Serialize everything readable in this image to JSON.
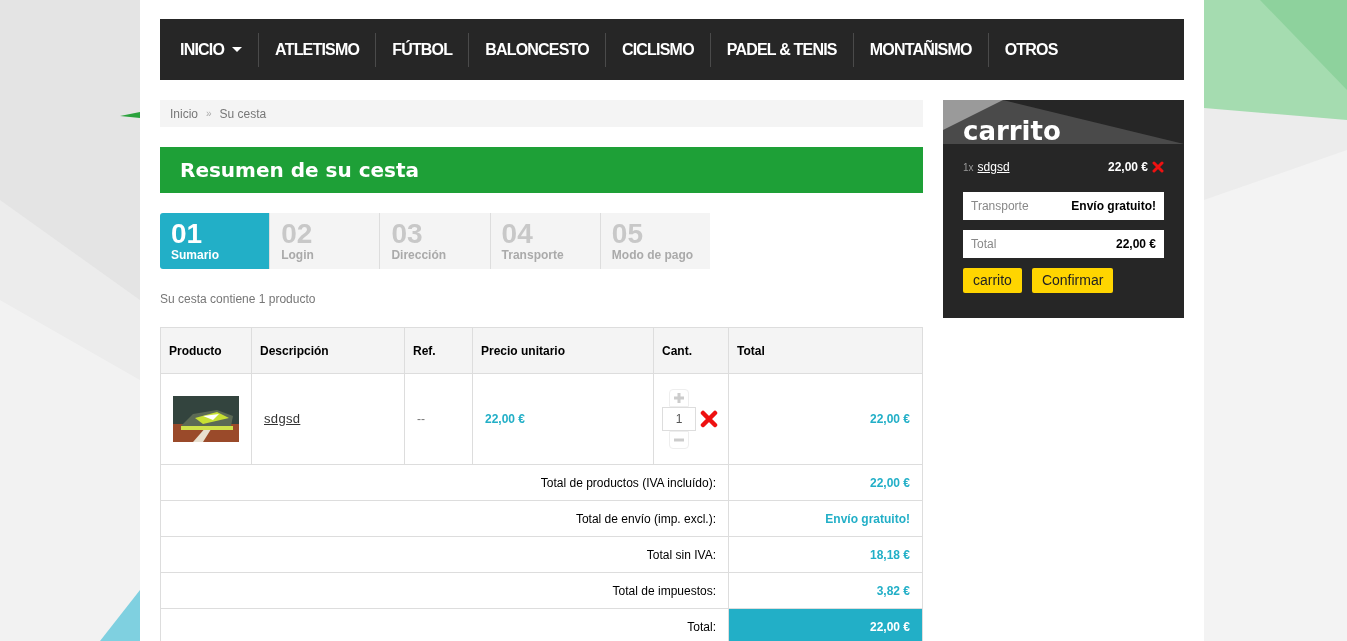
{
  "nav": [
    {
      "label": "INICIO",
      "has_caret": true
    },
    {
      "label": "ATLETISMO",
      "has_caret": false
    },
    {
      "label": "FÚTBOL",
      "has_caret": false
    },
    {
      "label": "BALONCESTO",
      "has_caret": false
    },
    {
      "label": "CICLISMO",
      "has_caret": false
    },
    {
      "label": "PADEL & TENIS",
      "has_caret": false
    },
    {
      "label": "MONTAÑISMO",
      "has_caret": false
    },
    {
      "label": "OTROS",
      "has_caret": false
    }
  ],
  "breadcrumb": [
    "Inicio",
    "Su cesta"
  ],
  "breadcrumb_separator": "»",
  "heading": "Resumen de su cesta",
  "steps": [
    {
      "number": "01",
      "label": "Sumario",
      "selected": true
    },
    {
      "number": "02",
      "label": "Login",
      "selected": false
    },
    {
      "number": "03",
      "label": "Dirección",
      "selected": false
    },
    {
      "number": "04",
      "label": "Transporte",
      "selected": false
    },
    {
      "number": "05",
      "label": "Modo de pago",
      "selected": false
    }
  ],
  "summary_text": "Su cesta contiene 1 producto",
  "table": {
    "columns": [
      "Producto",
      "Descripción",
      "Ref.",
      "Precio unitario",
      "Cant.",
      "Total"
    ],
    "rows": [
      {
        "description": "sdgsd",
        "ref": "--",
        "unit_price": "22,00 €",
        "quantity": "1",
        "total": "22,00 €"
      }
    ],
    "totals": [
      {
        "label": "Total de productos (IVA incluído):",
        "value": "22,00 €",
        "highlight": false
      },
      {
        "label": "Total de envío (imp. excl.):",
        "value": "Envío gratuito!",
        "highlight": false
      },
      {
        "label": "Total sin IVA:",
        "value": "18,18 €",
        "highlight": false
      },
      {
        "label": "Total de impuestos:",
        "value": "3,82 €",
        "highlight": false
      },
      {
        "label": "Total:",
        "value": "22,00 €",
        "highlight": true
      }
    ]
  },
  "cart": {
    "title": "carrito",
    "items": [
      {
        "quantity": "1x",
        "name": "sdgsd",
        "price": "22,00 €"
      }
    ],
    "lines": [
      {
        "label": "Transporte",
        "value": "Envío gratuito!"
      },
      {
        "label": "Total",
        "value": "22,00 €"
      }
    ],
    "buttons": [
      "carrito",
      "Confirmar"
    ]
  }
}
